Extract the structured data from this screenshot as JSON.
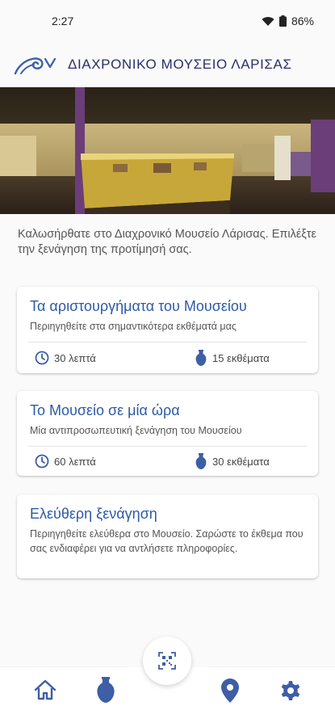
{
  "status": {
    "time": "2:27",
    "battery": "86%"
  },
  "header": {
    "title": "ΔΙΑΧΡΟΝΙΚΟ ΜΟΥΣΕΙΟ ΛΑΡΙΣΑΣ"
  },
  "intro": "Καλωσήρθατε στο Διαχρονικό Μουσείο Λάρισας. Επιλέξτε την ξενάγηση της προτίμησή σας.",
  "tours": [
    {
      "title": "Τα αριστουργήματα του Μουσείου",
      "description": "Περιηγηθείτε στα σημαντικότερα εκθέματά μας",
      "duration": "30 λεπτά",
      "exhibits": "15 εκθέματα"
    },
    {
      "title": "Το Μουσείο σε μία ώρα",
      "description": "Μία αντιπροσωπευτική ξενάγηση του Μουσείου",
      "duration": "60 λεπτά",
      "exhibits": "30 εκθέματα"
    },
    {
      "title": "Ελεύθερη ξενάγηση",
      "description": "Περιηγηθείτε ελεύθερα στο Μουσείο. Σαρώστε το έκθεμα που σας ενδιαφέρει για να αντλήσετε πληροφορίες."
    }
  ],
  "colors": {
    "accent": "#2d5aa6",
    "nav_icon": "#3e5ea6",
    "title": "#2b2f6a"
  },
  "icons": {
    "scan": "qr-scan-icon",
    "home": "home-icon",
    "exhibits": "amphora-icon",
    "location": "location-pin-icon",
    "settings": "gear-icon",
    "clock": "clock-icon"
  }
}
